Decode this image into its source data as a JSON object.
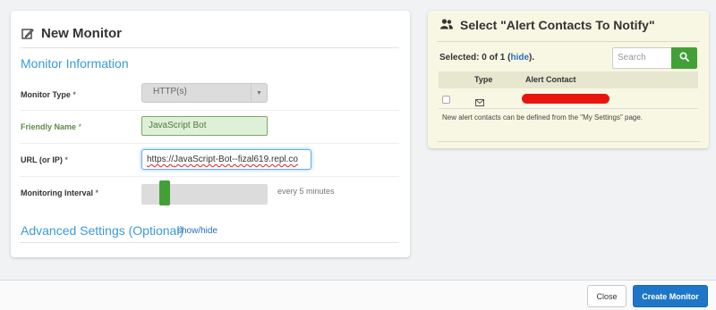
{
  "monitor_panel": {
    "title": "New Monitor",
    "section_title": "Monitor Information",
    "monitor_type": {
      "label": "Monitor Type",
      "required": "*",
      "value": "HTTP(s)"
    },
    "friendly_name": {
      "label": "Friendly Name",
      "required": "*",
      "value": "JavaScript Bot"
    },
    "url": {
      "label": "URL (or IP)",
      "required": "*",
      "value_prefix": "https://",
      "value_spelled": "JavaScript-Bot--fizal619.repl.co"
    },
    "interval": {
      "label": "Monitoring Interval",
      "required": "*",
      "value_text": "every 5 minutes",
      "slider_level": 0.14
    },
    "advanced": {
      "title": "Advanced Settings (Optional)",
      "toggle": "show/hide"
    }
  },
  "alert_panel": {
    "title": "Select \"Alert Contacts To Notify\"",
    "selected_prefix": "Selected: 0 of 1 (",
    "selected_hide": "hide",
    "selected_suffix": ").",
    "search_placeholder": "Search",
    "columns": {
      "type": "Type",
      "contact": "Alert Contact"
    },
    "rows": [
      {
        "type_icon": "envelope-icon",
        "contact": "[redacted]"
      }
    ],
    "note": "New alert contacts can be defined from the \"My Settings\" page."
  },
  "footer": {
    "close_label": "Close",
    "create_label": "Create Monitor"
  },
  "colors": {
    "accent_blue": "#3a9ad9",
    "primary_button": "#1e76c8",
    "success_green": "#43a036",
    "redaction_red": "#e8150f",
    "alert_panel_bg": "#f8f7e3"
  }
}
